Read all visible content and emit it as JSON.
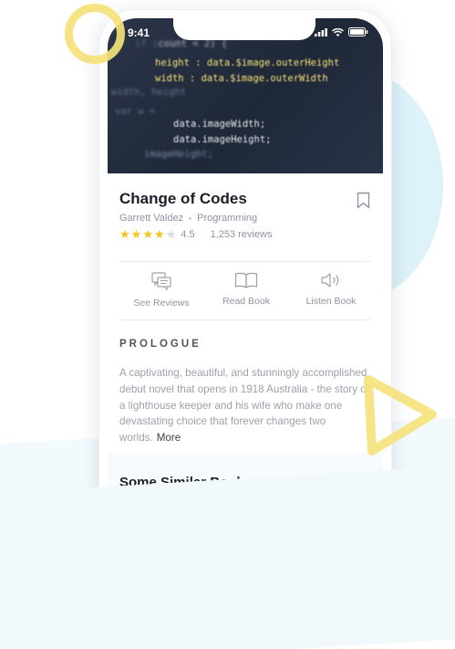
{
  "status_bar": {
    "time": "9:41"
  },
  "book": {
    "title": "Change of Codes",
    "author": "Garrett Valdez",
    "genre": "Programming",
    "rating": 4.5,
    "rating_text": "4.5",
    "stars_filled": 4,
    "stars_total": 5,
    "reviews": "1,253 reviews"
  },
  "hero_code": {
    "lines": [
      "count < 2) {",
      "height : data.$image.outerHeight",
      "width : data.$image.outerWidth",
      "data.imageWidth;",
      "data.imageHeight;",
      "imageHeight;"
    ]
  },
  "actions": [
    {
      "label": "See Reviews",
      "icon": "reviews-icon"
    },
    {
      "label": "Read Book",
      "icon": "book-icon"
    },
    {
      "label": "Listen Book",
      "icon": "speaker-icon"
    }
  ],
  "prologue": {
    "heading": "PROLOGUE",
    "text": "A captivating, beautiful, and stunningly accomplished debut novel that opens in 1918 Australia - the story of a lighthouse keeper and his wife who make one devastating choice that forever changes two worlds.",
    "more_label": "More"
  },
  "similar": {
    "heading": "Some Similar Books"
  },
  "colors": {
    "accent_star": "#f6c51a",
    "hero_bg": "#2b3548",
    "decor_yellow": "#f5e27a",
    "decor_blue": "#def2fa"
  }
}
